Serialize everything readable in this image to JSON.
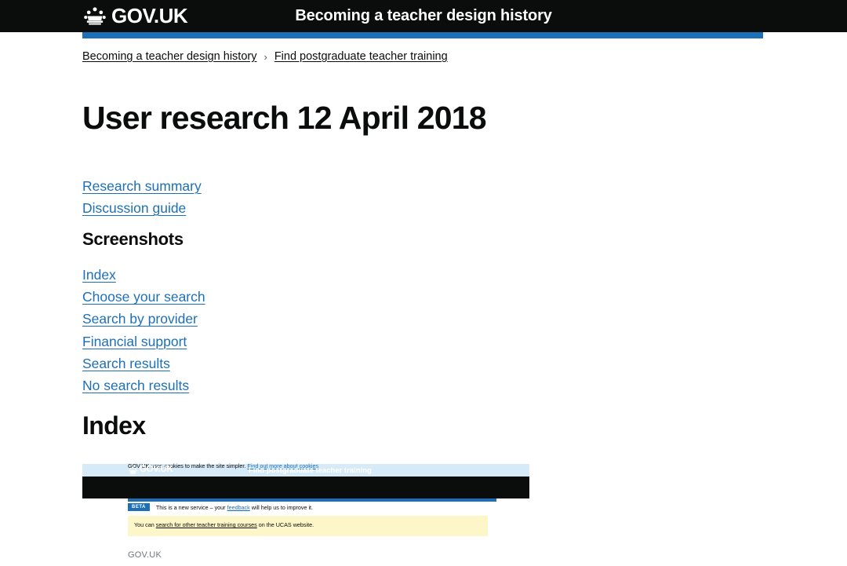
{
  "header": {
    "logo_text": "GOV.UK",
    "logo_icon": "crown-icon",
    "service_name": "Becoming a teacher design history",
    "accent_color": "#1d70b8",
    "background_color": "#0b0c0c"
  },
  "breadcrumb": {
    "items": [
      {
        "label": "Becoming a teacher design history"
      },
      {
        "label": "Find postgraduate teacher training"
      }
    ],
    "separator": "›"
  },
  "main": {
    "page_title": "User research 12 April 2018",
    "doc_links": [
      {
        "label": "Research summary"
      },
      {
        "label": "Discussion guide"
      }
    ],
    "screenshots_heading": "Screenshots",
    "screenshot_links": [
      {
        "label": "Index"
      },
      {
        "label": "Choose your search"
      },
      {
        "label": "Search by provider"
      },
      {
        "label": "Financial support"
      },
      {
        "label": "Search results"
      },
      {
        "label": "No search results"
      }
    ],
    "index_heading": "Index",
    "link_color": "#1d70b8"
  },
  "embedded_screenshot": {
    "cookie_banner": {
      "text": "GOV.UK uses cookies to make the site simpler.",
      "link_label": "Find out more about cookies",
      "background_color": "#d7eaf7"
    },
    "header": {
      "logo_text": "GOV.UK",
      "logo_icon": "crown-icon",
      "service_name": "Find postgraduate teacher training"
    },
    "beta_banner": {
      "tag": "BETA",
      "text_before": "This is a new service – your ",
      "link_label": "feedback",
      "text_after": " will help us to improve it."
    },
    "notice": {
      "text_before": "You can ",
      "link_label": "search for other teacher training courses",
      "text_after": " on the UCAS website.",
      "background_color": "#fdf6c8"
    },
    "footer_text": "GOV.UK"
  }
}
